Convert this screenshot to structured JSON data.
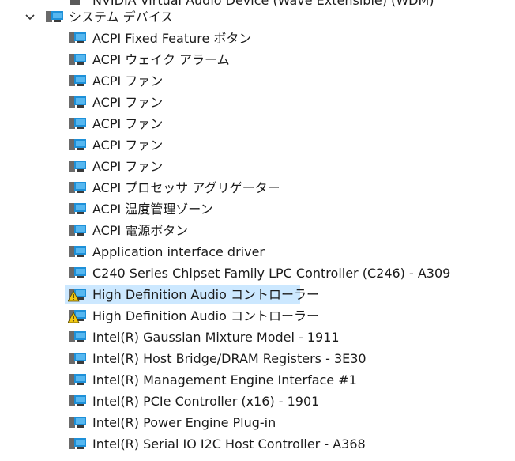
{
  "top_partial_label": "NVIDIA Virtual Audio Device (Wave Extensible) (WDM)",
  "category": {
    "label": "システム デバイス",
    "expanded": true,
    "icon": "system-devices-icon"
  },
  "devices": [
    {
      "label": "ACPI Fixed Feature ボタン",
      "icon": "device-icon",
      "warning": false
    },
    {
      "label": "ACPI ウェイク アラーム",
      "icon": "device-icon",
      "warning": false
    },
    {
      "label": "ACPI ファン",
      "icon": "device-icon",
      "warning": false
    },
    {
      "label": "ACPI ファン",
      "icon": "device-icon",
      "warning": false
    },
    {
      "label": "ACPI ファン",
      "icon": "device-icon",
      "warning": false
    },
    {
      "label": "ACPI ファン",
      "icon": "device-icon",
      "warning": false
    },
    {
      "label": "ACPI ファン",
      "icon": "device-icon",
      "warning": false
    },
    {
      "label": "ACPI プロセッサ アグリゲーター",
      "icon": "device-icon",
      "warning": false
    },
    {
      "label": "ACPI 温度管理ゾーン",
      "icon": "device-icon",
      "warning": false
    },
    {
      "label": "ACPI 電源ボタン",
      "icon": "device-icon",
      "warning": false
    },
    {
      "label": "Application interface driver",
      "icon": "device-icon",
      "warning": false
    },
    {
      "label": "C240 Series Chipset Family LPC Controller (C246) - A309",
      "icon": "device-icon",
      "warning": false
    },
    {
      "label": "High Definition Audio コントローラー",
      "icon": "device-warning-icon",
      "warning": true,
      "selected": true
    },
    {
      "label": "High Definition Audio コントローラー",
      "icon": "device-warning-icon",
      "warning": true
    },
    {
      "label": "Intel(R) Gaussian Mixture Model - 1911",
      "icon": "device-icon",
      "warning": false
    },
    {
      "label": "Intel(R) Host Bridge/DRAM Registers - 3E30",
      "icon": "device-icon",
      "warning": false
    },
    {
      "label": "Intel(R) Management Engine Interface #1",
      "icon": "device-icon",
      "warning": false
    },
    {
      "label": "Intel(R) PCIe Controller (x16) - 1901",
      "icon": "device-icon",
      "warning": false
    },
    {
      "label": "Intel(R) Power Engine Plug-in",
      "icon": "device-icon",
      "warning": false
    },
    {
      "label": "Intel(R) Serial IO I2C Host Controller - A368",
      "icon": "device-icon",
      "warning": false
    }
  ],
  "colors": {
    "selection": "#cce8ff",
    "text": "#1b1b1b",
    "monitor_blue": "#1e90d8",
    "warning_yellow": "#f2c811"
  }
}
